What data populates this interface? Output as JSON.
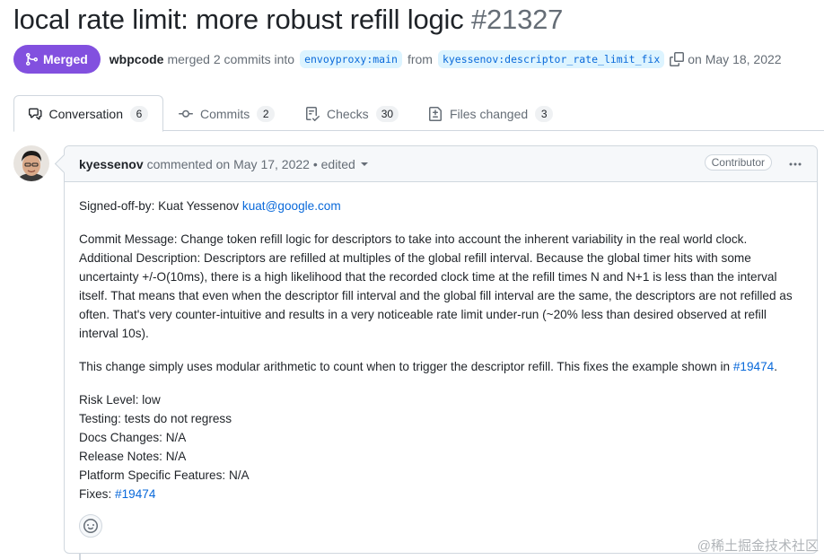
{
  "pr": {
    "title": "local rate limit: more robust refill logic",
    "number": "#21327",
    "state": "Merged",
    "author": "wbpcode",
    "merged_text": "merged 2 commits into",
    "base_branch": "envoyproxy:main",
    "from_text": "from",
    "head_branch": "kyessenov:descriptor_rate_limit_fix",
    "date_text": "on May 18, 2022"
  },
  "tabs": [
    {
      "label": "Conversation",
      "count": "6",
      "icon": "comment-discussion-icon"
    },
    {
      "label": "Commits",
      "count": "2",
      "icon": "git-commit-icon"
    },
    {
      "label": "Checks",
      "count": "30",
      "icon": "checklist-icon"
    },
    {
      "label": "Files changed",
      "count": "3",
      "icon": "file-diff-icon"
    }
  ],
  "comment": {
    "login": "kyessenov",
    "action": "commented on May 17, 2022 • edited",
    "role": "Contributor",
    "signed_off_prefix": "Signed-off-by: Kuat Yessenov ",
    "signed_off_email": "kuat@google.com",
    "commit_message": "Commit Message: Change token refill logic for descriptors to take into account the inherent variability in the real world clock.",
    "additional_description": "Additional Description: Descriptors are refilled at multiples of the global refill interval. Because the global timer hits with some uncertainty +/-O(10ms), there is a high likelihood that the recorded clock time at the refill times N and N+1 is less than the interval itself. That means that even when the descriptor fill interval and the global fill interval are the same, the descriptors are not refilled as often. That's very counter-intuitive and results in a very noticeable rate limit under-run (~20% less than desired observed at refill interval 10s).",
    "change_text": "This change simply uses modular arithmetic to count when to trigger the descriptor refill. This fixes the example shown in ",
    "change_link": "#19474",
    "change_end": ".",
    "risk_level": "Risk Level: low",
    "testing": "Testing: tests do not regress",
    "docs_changes": "Docs Changes: N/A",
    "release_notes": "Release Notes: N/A",
    "platform_features": "Platform Specific Features: N/A",
    "fixes_prefix": "Fixes: ",
    "fixes_link": "#19474"
  },
  "watermark": "@稀土掘金技术社区",
  "colors": {
    "merged": "#8250df",
    "link": "#0969da",
    "muted": "#656d76"
  }
}
